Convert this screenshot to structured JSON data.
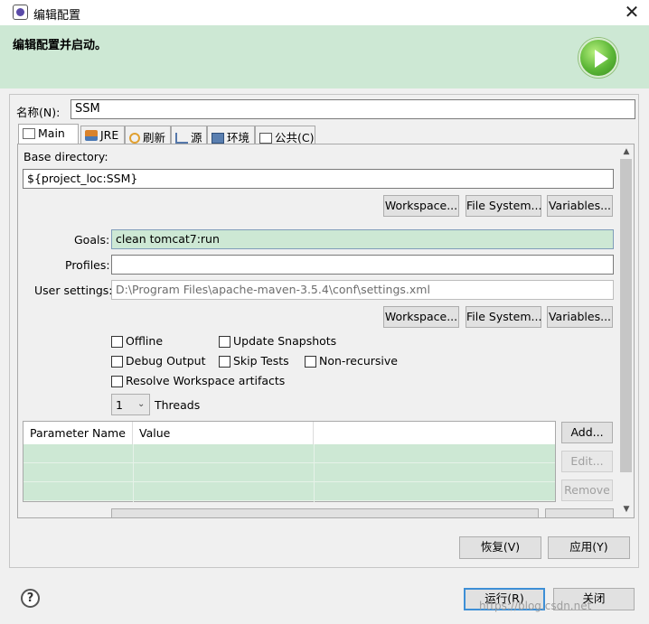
{
  "window": {
    "title": "编辑配置",
    "close_glyph": "✕",
    "banner_title": "编辑配置并启动。"
  },
  "name": {
    "label": "名称(N):",
    "value": "SSM"
  },
  "tabs": [
    {
      "label": "Main",
      "icon": "main-tab-icon"
    },
    {
      "label": "JRE",
      "icon": "jre-icon"
    },
    {
      "label": "刷新",
      "icon": "refresh-icon"
    },
    {
      "label": "源",
      "icon": "source-icon"
    },
    {
      "label": "环境",
      "icon": "environment-icon"
    },
    {
      "label": "公共(C)",
      "icon": "common-icon"
    }
  ],
  "main": {
    "base_directory": {
      "label": "Base directory:",
      "value": "${project_loc:SSM}"
    },
    "buttons": {
      "workspace": "Workspace...",
      "file_system": "File System...",
      "variables": "Variables..."
    },
    "goals": {
      "label": "Goals:",
      "value": "clean tomcat7:run"
    },
    "profiles": {
      "label": "Profiles:",
      "value": ""
    },
    "user_settings": {
      "label": "User settings:",
      "value": "D:\\Program Files\\apache-maven-3.5.4\\conf\\settings.xml"
    },
    "checkboxes": {
      "offline": "Offline",
      "update_snapshots": "Update Snapshots",
      "debug_output": "Debug Output",
      "skip_tests": "Skip Tests",
      "non_recursive": "Non-recursive",
      "resolve_workspace": "Resolve Workspace artifacts"
    },
    "threads": {
      "value": "1",
      "label": "Threads"
    },
    "table": {
      "columns": [
        "Parameter Name",
        "Value"
      ],
      "rows": []
    },
    "table_buttons": {
      "add": "Add...",
      "edit": "Edit...",
      "remove": "Remove"
    }
  },
  "footer": {
    "revert": "恢复(V)",
    "apply": "应用(Y)",
    "run": "运行(R)",
    "close": "关闭",
    "help": "?",
    "watermark": "https://blog.csdn.net"
  },
  "colors": {
    "banner": "#cde8d4",
    "highlight": "#cde8d4",
    "default_button_border": "#3d8fd6"
  }
}
